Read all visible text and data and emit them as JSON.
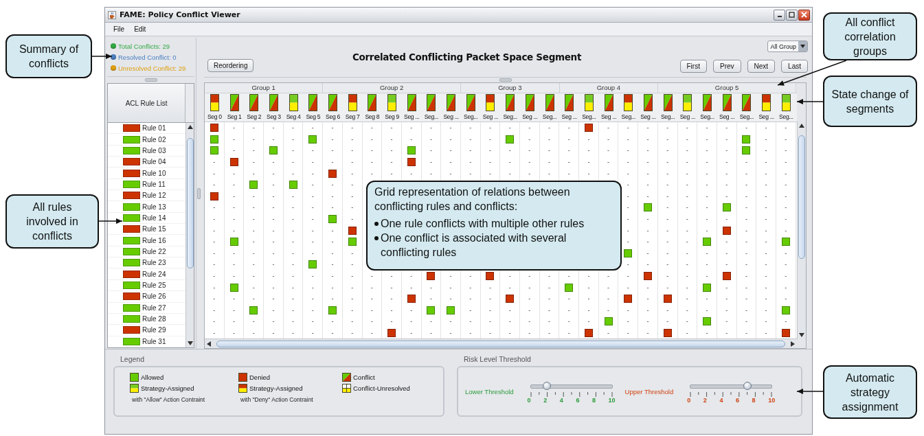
{
  "window": {
    "title": "FAME: Policy Conflict Viewer"
  },
  "menu": [
    "File",
    "Edit"
  ],
  "summary": [
    {
      "text": "Total Conflicts: 29",
      "color": "#33aa44"
    },
    {
      "text": "Resolved Conflict: 0",
      "color": "#4a7fc0"
    },
    {
      "text": "Unresolved Conflict: 29",
      "color": "#e0a010"
    }
  ],
  "rule_list": {
    "header": "ACL Rule List",
    "rules": [
      {
        "label": "Rule 01",
        "kind": "denied"
      },
      {
        "label": "Rule 02",
        "kind": "allowed"
      },
      {
        "label": "Rule 03",
        "kind": "allowed"
      },
      {
        "label": "Rule 04",
        "kind": "denied"
      },
      {
        "label": "Rule 10",
        "kind": "denied"
      },
      {
        "label": "Rule 11",
        "kind": "allowed"
      },
      {
        "label": "Rule 12",
        "kind": "denied"
      },
      {
        "label": "Rule 13",
        "kind": "allowed"
      },
      {
        "label": "Rule 14",
        "kind": "allowed"
      },
      {
        "label": "Rule 15",
        "kind": "denied"
      },
      {
        "label": "Rule 16",
        "kind": "allowed"
      },
      {
        "label": "Rule 22",
        "kind": "allowed"
      },
      {
        "label": "Rule 23",
        "kind": "allowed"
      },
      {
        "label": "Rule 24",
        "kind": "denied"
      },
      {
        "label": "Rule 25",
        "kind": "allowed"
      },
      {
        "label": "Rule 26",
        "kind": "denied"
      },
      {
        "label": "Rule 27",
        "kind": "allowed"
      },
      {
        "label": "Rule 28",
        "kind": "allowed"
      },
      {
        "label": "Rule 29",
        "kind": "denied"
      },
      {
        "label": "Rule 31",
        "kind": "allowed"
      }
    ]
  },
  "toolbar": {
    "reorder_button": "Reordering",
    "title": "Correlated Conflicting Packet Space Segment",
    "group_select": "All Group",
    "nav_buttons": [
      "First",
      "Prev",
      "Next",
      "Last"
    ]
  },
  "groups": [
    {
      "label": "Group 1",
      "segments": [
        {
          "label": "Seg 0",
          "kind": "deny-assigned"
        },
        {
          "label": "Seg 1",
          "kind": "conflict"
        },
        {
          "label": "Seg 2",
          "kind": "conflict"
        },
        {
          "label": "Seg 3",
          "kind": "conflict"
        },
        {
          "label": "Seg 4",
          "kind": "allow-assigned"
        },
        {
          "label": "Seg 5",
          "kind": "conflict"
        }
      ]
    },
    {
      "label": "Group 2",
      "segments": [
        {
          "label": "Seg 6",
          "kind": "conflict"
        },
        {
          "label": "Seg 7",
          "kind": "deny-assigned"
        },
        {
          "label": "Seg 8",
          "kind": "conflict"
        },
        {
          "label": "Seg 9",
          "kind": "allow-assigned"
        },
        {
          "label": "Seg ...",
          "kind": "conflict"
        },
        {
          "label": "Seg...",
          "kind": "conflict"
        },
        {
          "label": "Seg ...",
          "kind": "conflict"
        }
      ]
    },
    {
      "label": "Group 3",
      "segments": [
        {
          "label": "Seg...",
          "kind": "conflict"
        },
        {
          "label": "Seg ...",
          "kind": "deny-assigned"
        },
        {
          "label": "Seg...",
          "kind": "conflict"
        },
        {
          "label": "Seg ...",
          "kind": "conflict"
        },
        {
          "label": "Seg...",
          "kind": "conflict"
        }
      ]
    },
    {
      "label": "Group 4",
      "segments": [
        {
          "label": "Seg ...",
          "kind": "conflict"
        },
        {
          "label": "Seg...",
          "kind": "allow-assigned"
        },
        {
          "label": "Seg ...",
          "kind": "conflict"
        },
        {
          "label": "Seg...",
          "kind": "deny-assigned"
        },
        {
          "label": "Seg ...",
          "kind": "conflict"
        }
      ]
    },
    {
      "label": "Group 5",
      "segments": [
        {
          "label": "Seg...",
          "kind": "conflict"
        },
        {
          "label": "Seg ...",
          "kind": "allow-assigned"
        },
        {
          "label": "Seg...",
          "kind": "conflict"
        },
        {
          "label": "Seg ...",
          "kind": "conflict"
        },
        {
          "label": "Seg...",
          "kind": "conflict"
        },
        {
          "label": "Seg ...",
          "kind": "deny-assigned"
        },
        {
          "label": "Seg...",
          "kind": "allow-assigned"
        }
      ]
    }
  ],
  "grid_rows": [
    [
      {
        "kind": "denied"
      },
      "-",
      "-",
      "-",
      "-",
      "-",
      "-",
      "-",
      "-",
      "-",
      "-",
      "-",
      "-",
      "-",
      "-",
      "-",
      "-",
      "-",
      "-",
      {
        "kind": "denied"
      },
      "-",
      "-",
      "-",
      "-",
      "-",
      "-",
      "-",
      "-",
      "-",
      "-"
    ],
    [
      {
        "kind": "allowed"
      },
      "-",
      "-",
      "-",
      "-",
      {
        "kind": "allowed"
      },
      "-",
      "-",
      "-",
      "-",
      "-",
      "-",
      "-",
      "-",
      "-",
      {
        "kind": "allowed"
      },
      "-",
      "-",
      "-",
      "-",
      "-",
      "-",
      "-",
      "-",
      "-",
      "-",
      "-",
      {
        "kind": "allowed"
      },
      "-",
      "-"
    ],
    [
      {
        "kind": "allowed"
      },
      "-",
      "-",
      {
        "kind": "allowed"
      },
      "-",
      "-",
      "-",
      "-",
      "-",
      "-",
      {
        "kind": "allowed"
      },
      "-",
      "-",
      "-",
      "-",
      "-",
      "-",
      "-",
      "-",
      "-",
      "-",
      "-",
      "-",
      "-",
      "-",
      "-",
      "-",
      {
        "kind": "allowed"
      },
      "-",
      "-"
    ],
    [
      "-",
      {
        "kind": "denied"
      },
      "-",
      "-",
      "-",
      "-",
      "-",
      "-",
      "-",
      "-",
      {
        "kind": "denied"
      },
      "-",
      "-",
      "-",
      "-",
      "-",
      "-",
      "-",
      "-",
      "-",
      "-",
      "-",
      "-",
      "-",
      "-",
      "-",
      "-",
      "-",
      "-",
      "-"
    ],
    [
      "-",
      "-",
      "-",
      "-",
      "-",
      "-",
      {
        "kind": "denied"
      },
      "-",
      "-",
      "-",
      "-",
      "-",
      "-",
      "-",
      "-",
      "-",
      "-",
      "-",
      "-",
      "-",
      "-",
      "-",
      "-",
      "-",
      "-",
      "-",
      "-",
      "-",
      "-",
      "-"
    ],
    [
      "-",
      "-",
      {
        "kind": "allowed"
      },
      "-",
      {
        "kind": "allowed"
      },
      "-",
      "-",
      "-",
      null,
      null,
      null,
      null,
      null,
      null,
      null,
      null,
      null,
      null,
      null,
      null,
      null,
      "-",
      "-",
      "-",
      "-",
      "-",
      "-",
      "-",
      "-",
      "-"
    ],
    [
      {
        "kind": "denied"
      },
      "-",
      "-",
      "-",
      "-",
      "-",
      "-",
      "-",
      null,
      null,
      null,
      null,
      null,
      null,
      null,
      null,
      null,
      null,
      null,
      null,
      null,
      "-",
      "-",
      "-",
      "-",
      "-",
      "-",
      "-",
      "-",
      "-"
    ],
    [
      "-",
      "-",
      "-",
      "-",
      "-",
      "-",
      "-",
      "-",
      null,
      null,
      null,
      null,
      null,
      null,
      null,
      null,
      null,
      null,
      null,
      null,
      null,
      "-",
      {
        "kind": "allowed"
      },
      "-",
      "-",
      "-",
      {
        "kind": "allowed"
      },
      "-",
      "-",
      "-"
    ],
    [
      "-",
      "-",
      "-",
      "-",
      "-",
      "-",
      {
        "kind": "allowed"
      },
      "-",
      null,
      null,
      null,
      null,
      null,
      null,
      null,
      null,
      null,
      null,
      null,
      null,
      null,
      "-",
      "-",
      "-",
      "-",
      "-",
      "-",
      "-",
      "-",
      "-"
    ],
    [
      "-",
      "-",
      "-",
      "-",
      "-",
      "-",
      "-",
      {
        "kind": "denied"
      },
      null,
      null,
      null,
      null,
      null,
      null,
      null,
      null,
      null,
      null,
      null,
      null,
      null,
      "-",
      "-",
      "-",
      "-",
      "-",
      {
        "kind": "denied"
      },
      "-",
      "-",
      "-"
    ],
    [
      "-",
      {
        "kind": "allowed"
      },
      "-",
      "-",
      "-",
      "-",
      "-",
      {
        "kind": "allowed"
      },
      null,
      null,
      null,
      null,
      null,
      null,
      null,
      null,
      null,
      null,
      null,
      null,
      null,
      "-",
      "-",
      "-",
      "-",
      {
        "kind": "allowed"
      },
      "-",
      "-",
      "-",
      {
        "kind": "allowed"
      }
    ],
    [
      "-",
      "-",
      "-",
      "-",
      "-",
      "-",
      "-",
      "-",
      null,
      null,
      null,
      null,
      null,
      null,
      null,
      null,
      null,
      null,
      null,
      null,
      null,
      {
        "kind": "allowed"
      },
      "-",
      "-",
      "-",
      "-",
      "-",
      "-",
      "-",
      "-"
    ],
    [
      "-",
      "-",
      "-",
      "-",
      "-",
      {
        "kind": "allowed"
      },
      "-",
      "-",
      null,
      null,
      null,
      null,
      null,
      null,
      null,
      null,
      null,
      null,
      null,
      null,
      null,
      "-",
      "-",
      "-",
      "-",
      "-",
      "-",
      "-",
      "-",
      "-"
    ],
    [
      "-",
      "-",
      "-",
      "-",
      "-",
      "-",
      "-",
      "-",
      "-",
      "-",
      "-",
      {
        "kind": "denied"
      },
      "-",
      "-",
      {
        "kind": "denied"
      },
      "-",
      "-",
      "-",
      "-",
      "-",
      "-",
      "-",
      {
        "kind": "denied"
      },
      "-",
      "-",
      "-",
      {
        "kind": "denied"
      },
      "-",
      "-",
      "-"
    ],
    [
      "-",
      {
        "kind": "allowed"
      },
      "-",
      "-",
      "-",
      "-",
      "-",
      "-",
      "-",
      "-",
      "-",
      "-",
      "-",
      "-",
      "-",
      "-",
      "-",
      "-",
      {
        "kind": "allowed"
      },
      "-",
      "-",
      "-",
      "-",
      "-",
      "-",
      {
        "kind": "allowed"
      },
      "-",
      "-",
      "-",
      "-"
    ],
    [
      "-",
      "-",
      "-",
      "-",
      "-",
      "-",
      "-",
      "-",
      "-",
      "-",
      {
        "kind": "denied"
      },
      "-",
      "-",
      "-",
      "-",
      {
        "kind": "denied"
      },
      "-",
      "-",
      "-",
      "-",
      "-",
      {
        "kind": "denied"
      },
      "-",
      {
        "kind": "denied"
      },
      "-",
      "-",
      "-",
      "-",
      "-",
      "-"
    ],
    [
      "-",
      "-",
      {
        "kind": "allowed"
      },
      "-",
      "-",
      "-",
      {
        "kind": "allowed"
      },
      "-",
      "-",
      "-",
      "-",
      {
        "kind": "allowed"
      },
      {
        "kind": "allowed"
      },
      "-",
      "-",
      "-",
      "-",
      "-",
      "-",
      "-",
      "-",
      "-",
      "-",
      "-",
      "-",
      "-",
      "-",
      "-",
      "-",
      {
        "kind": "allowed"
      }
    ],
    [
      "-",
      "-",
      "-",
      "-",
      "-",
      "-",
      "-",
      "-",
      "-",
      "-",
      "-",
      "-",
      "-",
      "-",
      "-",
      "-",
      "-",
      "-",
      "-",
      "-",
      {
        "kind": "allowed"
      },
      "-",
      "-",
      "-",
      "-",
      {
        "kind": "allowed"
      },
      "-",
      "-",
      "-",
      "-"
    ],
    [
      "-",
      "-",
      "-",
      "-",
      "-",
      "-",
      "-",
      "-",
      "-",
      {
        "kind": "denied"
      },
      "-",
      "-",
      "-",
      "-",
      "-",
      "-",
      "-",
      "-",
      "-",
      {
        "kind": "denied"
      },
      "-",
      "-",
      "-",
      {
        "kind": "denied"
      },
      "-",
      "-",
      "-",
      "-",
      "-",
      {
        "kind": "denied"
      }
    ]
  ],
  "legend": {
    "title": "Legend",
    "items": [
      {
        "label": "Allowed",
        "kind": "allowed"
      },
      {
        "label": "Denied",
        "kind": "denied"
      },
      {
        "label": "Conflict",
        "kind": "conflict"
      },
      {
        "label": "Strategy-Assigned",
        "kind": "allow-assigned",
        "note": "with \"Allow\" Action Contraint"
      },
      {
        "label": "Strategy-Assigned",
        "kind": "deny-assigned",
        "note": "with \"Deny\" Action Contraint"
      },
      {
        "label": "Conflict-Unresolved",
        "kind": "unresolved"
      }
    ]
  },
  "risk": {
    "title": "Risk Level Threshold",
    "sliders": [
      {
        "label": "Lower Threshold",
        "level": 0.2,
        "color": "#2a9a3a",
        "ticks": [
          "0",
          "2",
          "4",
          "6",
          "8",
          "10"
        ]
      },
      {
        "label": "Upper Threshold",
        "level": 0.7,
        "color": "#d04010",
        "ticks": [
          "0",
          "2",
          "4",
          "6",
          "8",
          "10"
        ]
      }
    ]
  },
  "annotations": [
    {
      "text": "Summary of conflicts"
    },
    {
      "text": "All rules involved in conflicts"
    },
    {
      "text": "All conflict correlation groups"
    },
    {
      "text": "State change of segments"
    },
    {
      "text": "Automatic strategy assignment"
    },
    {
      "text": "Grid representation of relations between conflicting rules and conflicts:",
      "bullets": [
        "One rule conflicts with multiple other rules",
        "One conflict is associated with several conflicting rules"
      ]
    }
  ]
}
